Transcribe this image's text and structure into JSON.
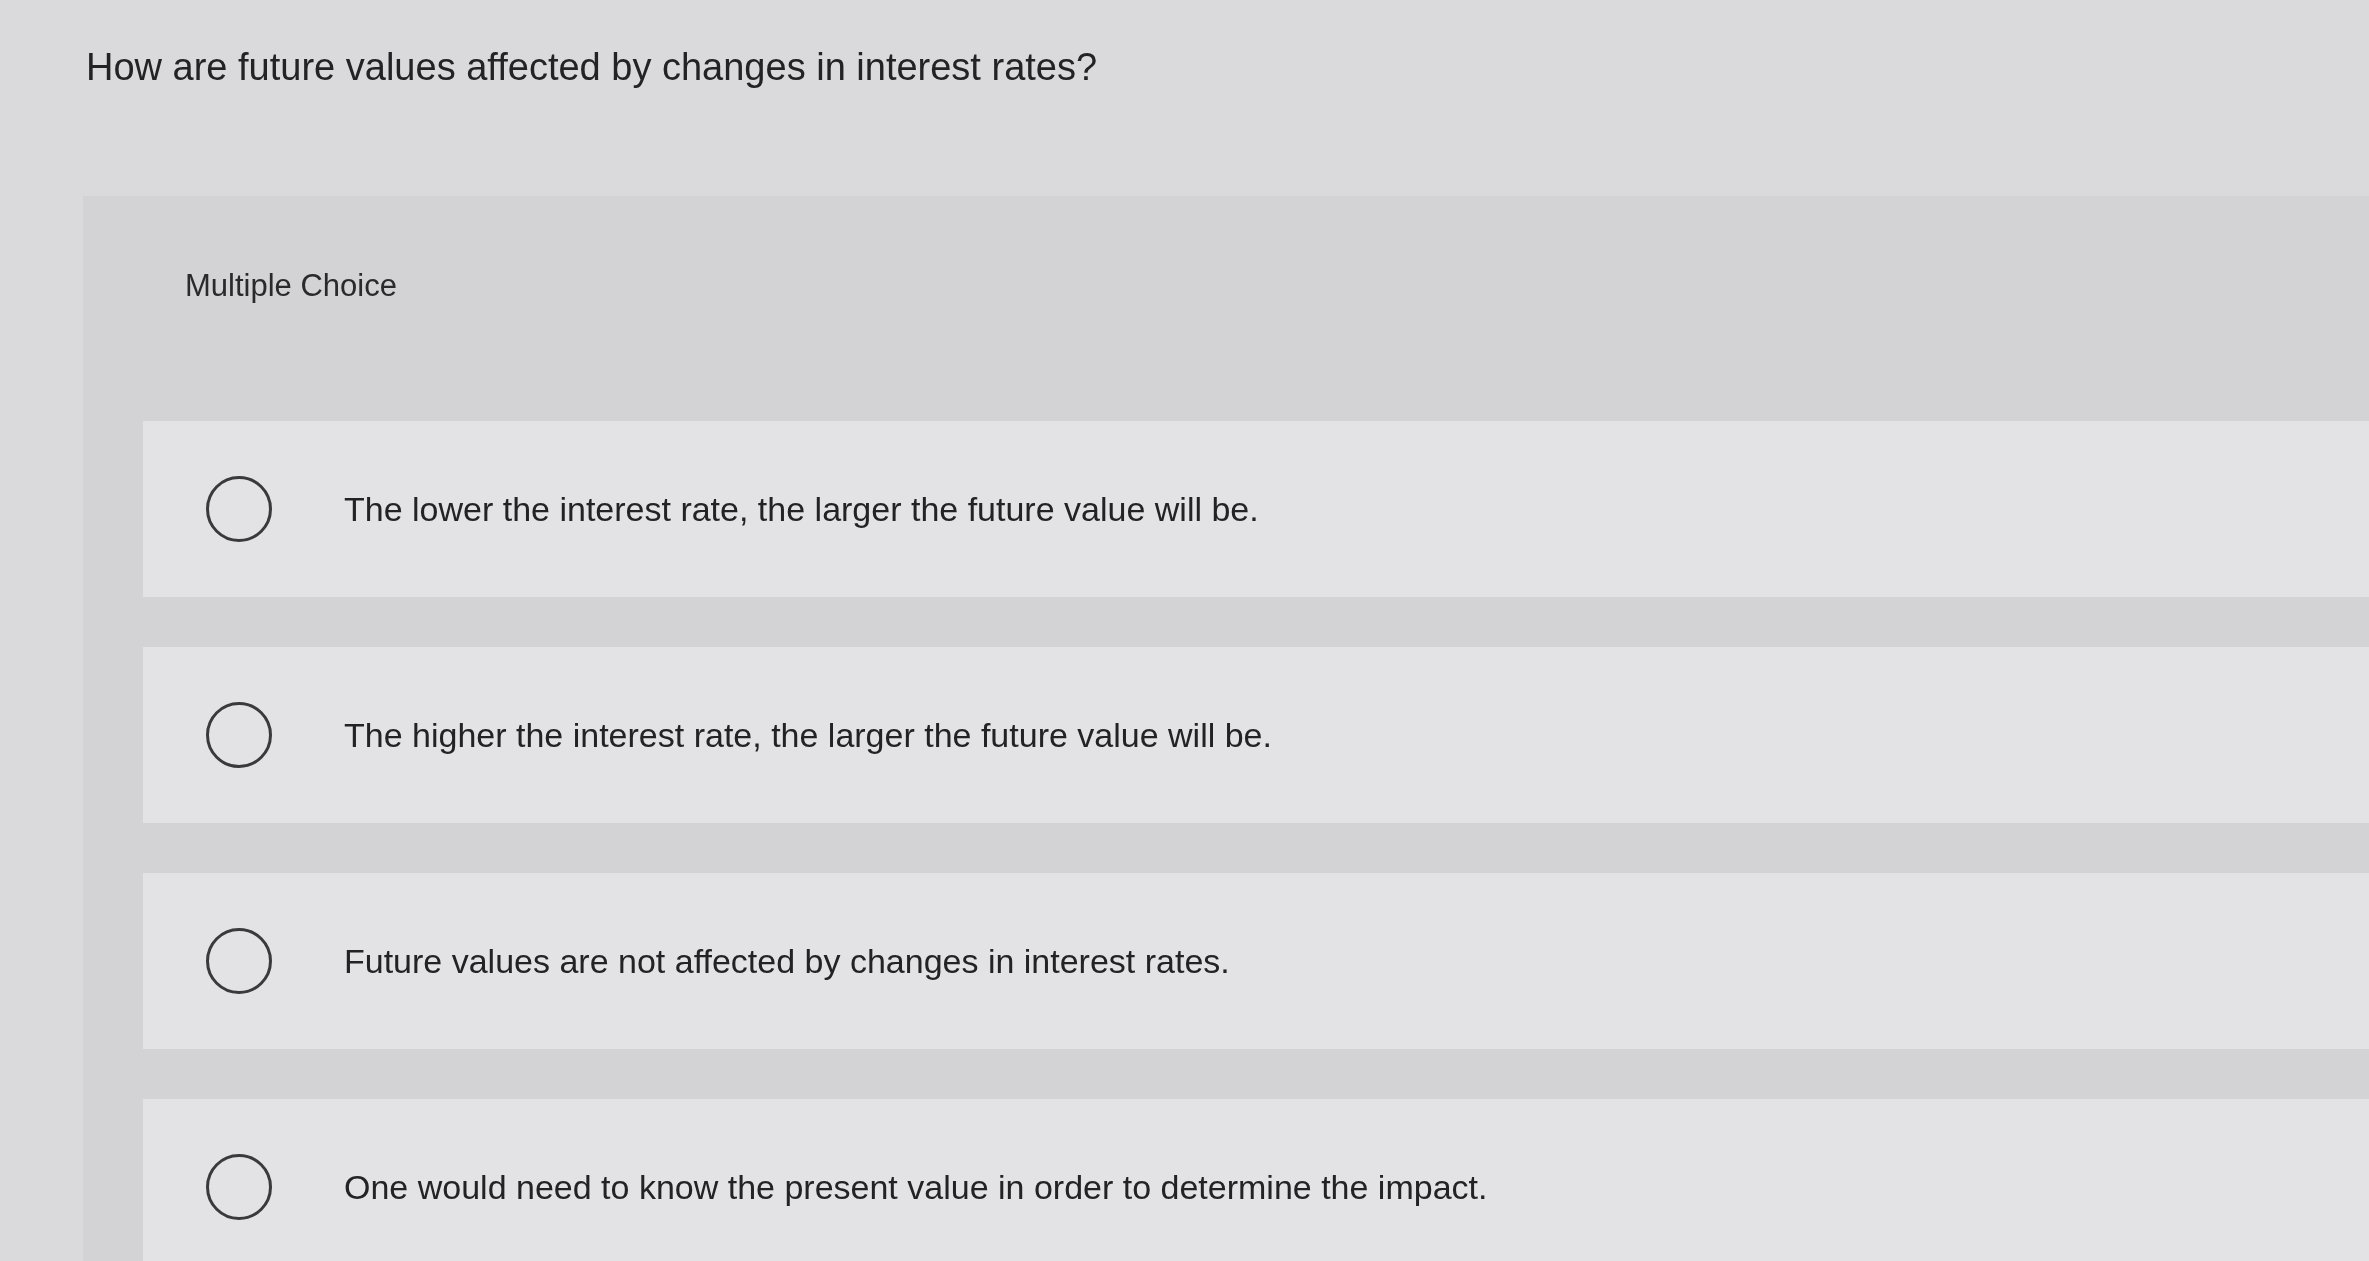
{
  "question": {
    "text": "How are future values affected by changes in interest rates?"
  },
  "answer_panel": {
    "label": "Multiple Choice",
    "options": [
      {
        "text": "The lower the interest rate, the larger the future value will be.",
        "selected": false
      },
      {
        "text": "The higher the interest rate, the larger the future value will be.",
        "selected": false
      },
      {
        "text": "Future values are not affected by changes in interest rates.",
        "selected": false
      },
      {
        "text": "One would need to know the present value in order to determine the impact.",
        "selected": false
      }
    ]
  }
}
